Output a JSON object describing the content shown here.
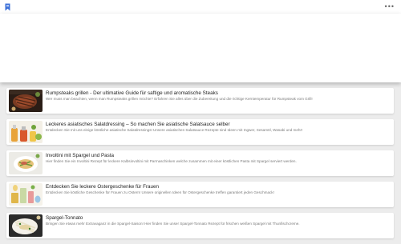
{
  "header": {
    "bookmark_icon": "bookmark-icon",
    "more_label": "•••",
    "accent": "#3b6fd8"
  },
  "articles": [
    {
      "title": "Rumpsteaks grillen - Der ultimative Guide für saftige und aromatische Steaks",
      "description": "Wer muss man beachten, wenn man Rumpsteaks grillen möchte? Erfahren Sie alles über die Zubereitung und die richtige Kerntemperatur für Rumpsteak vom Grill!",
      "thumbnail": "steak-image"
    },
    {
      "title": "Leckeres asiatisches Salatdressing – So machen Sie asiatische Salatsauce selber",
      "description": "Entdecken Sie mit uns einige köstliche asiatische Salatdressings! Unsere asiatischen Salatsauce Rezepte sind Ideen mit Ingwer, Sesamöl, Wasabi und mehr!",
      "thumbnail": "dressing-image"
    },
    {
      "title": "Involtini mit Spargel und Pasta",
      "description": "Hier finden Sie ein Involtini Rezept für leckere Kalbsinvoltini mit Parmaschinken welche zusammen mit einer köstlichen Pasta mit Spargel serviert werden.",
      "thumbnail": "involtini-image"
    },
    {
      "title": "Entdecken Sie leckere Ostergeschenke für Frauen",
      "description": "Entdecken Sie köstliche Geschenke für Frauen zu Ostern! Unsere originellen Ideen für Ostergeschenke treffen garantiert jeden Geschmack!",
      "thumbnail": "easter-gifts-image"
    },
    {
      "title": "Spargel-Tonnato",
      "description": "Bringen Sie etwas mehr Extravaganz in die Spargel-Saison! Hier finden Sie unser Spargel-Tonnato Rezept für frischen weißen Spargel mit Thunfischcreme.",
      "thumbnail": "spargel-tonnato-image"
    }
  ]
}
